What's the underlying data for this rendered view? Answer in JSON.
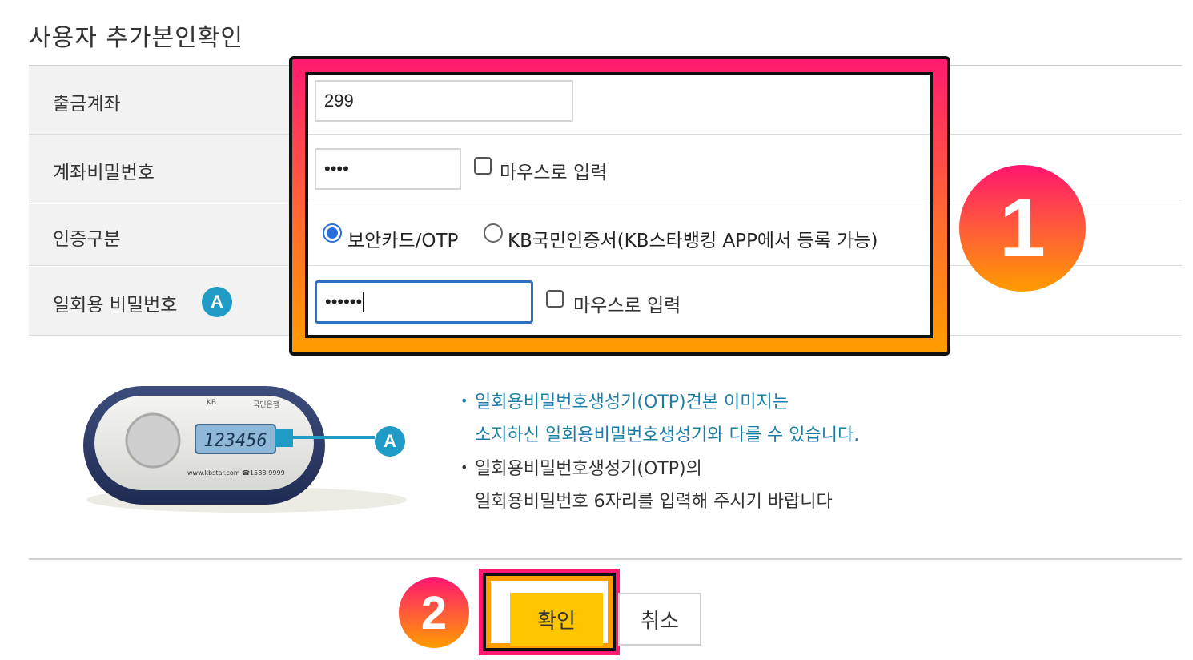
{
  "page": {
    "title": "사용자 추가본인확인"
  },
  "form": {
    "account": {
      "label": "출금계좌",
      "value": "299"
    },
    "account_password": {
      "label": "계좌비밀번호",
      "value": "••••",
      "mouse_input_label": "마우스로 입력"
    },
    "auth_type": {
      "label": "인증구분",
      "options": [
        {
          "label": "보안카드/OTP",
          "selected": true
        },
        {
          "label": "KB국민인증서(KB스타뱅킹 APP에서 등록 가능)",
          "selected": false
        }
      ]
    },
    "otp_password": {
      "label": "일회용 비밀번호",
      "badge": "A",
      "value": "••••••",
      "mouse_input_label": "마우스로 입력"
    }
  },
  "otp_device": {
    "display": "123456",
    "brand": "KB",
    "bank": "국민은행",
    "footer": "www.kbstar.com ☎1588-9999",
    "badge": "A"
  },
  "info": {
    "line1": "일회용비밀번호생성기(OTP)견본 이미지는",
    "line2": "소지하신 일회용비밀번호생성기와 다를 수 있습니다.",
    "line3": "일회용비밀번호생성기(OTP)의",
    "line4": "일회용비밀번호 6자리를 입력해 주시기 바랍니다"
  },
  "buttons": {
    "confirm": "확인",
    "cancel": "취소"
  },
  "annotations": {
    "badge1": "1",
    "badge2": "2"
  },
  "colors": {
    "accent_blue": "#2a6fdb",
    "confirm_yellow": "#ffc600",
    "info_blue": "#1a7ea6",
    "highlight_pink": "#ff1a70",
    "highlight_orange": "#ff9d00"
  }
}
